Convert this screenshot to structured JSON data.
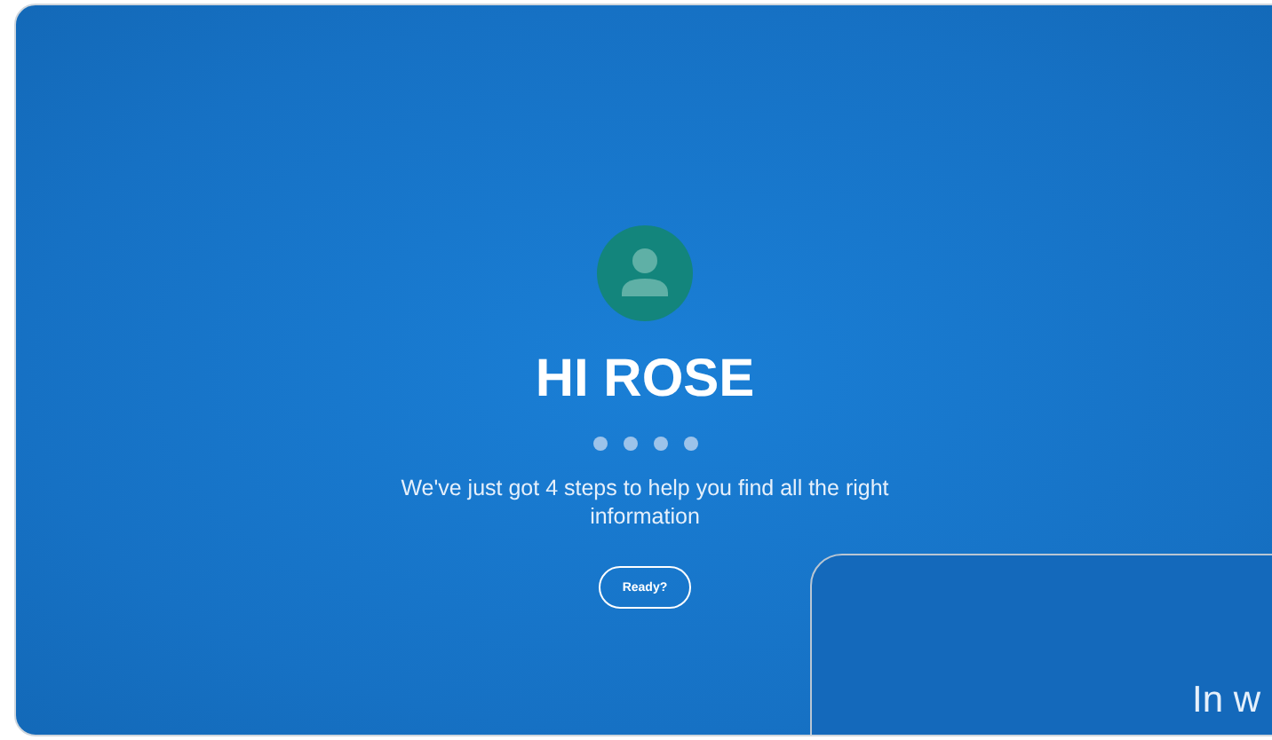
{
  "greeting": {
    "title": "HI ROSE",
    "steps": [
      {
        "selected": false
      },
      {
        "selected": false
      },
      {
        "selected": false
      },
      {
        "selected": false
      }
    ],
    "message": "We've just got 4 steps to help you find all the right information",
    "button": "Ready?"
  },
  "next_card": {
    "heading": "In w"
  }
}
